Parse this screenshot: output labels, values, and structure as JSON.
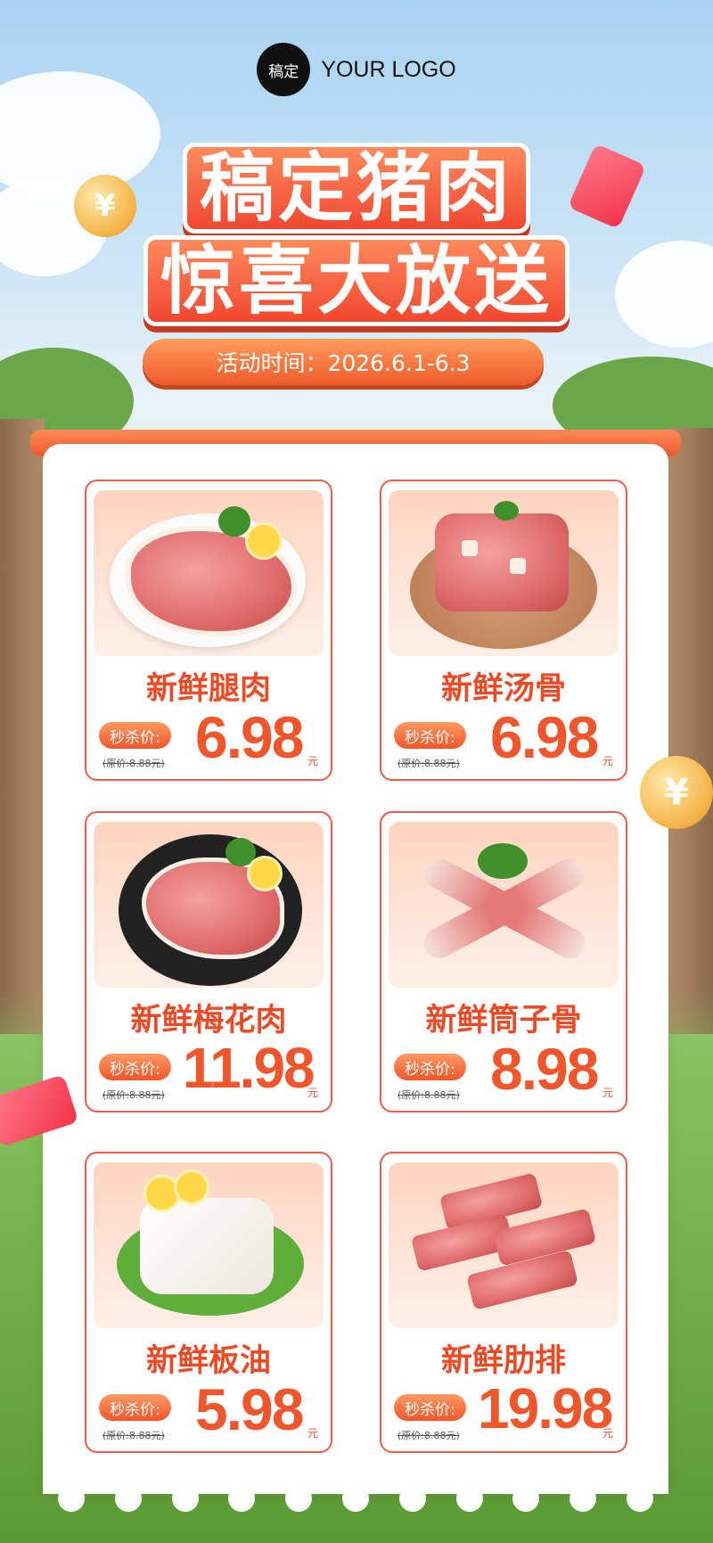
{
  "logo": {
    "badge": "稿定",
    "text": "YOUR LOGO"
  },
  "title": {
    "line1": "稿定猪肉",
    "line2": "惊喜大放送"
  },
  "event": {
    "label": "活动时间：2026.6.1-6.3"
  },
  "coin": {
    "symbol": "¥"
  },
  "colors": {
    "accent": "#f0562b",
    "card_border": "#f05a4a",
    "title_fill": "#f0472e"
  },
  "products": [
    {
      "name": "新鲜腿肉",
      "tag": "秒杀价:",
      "price": "6.98",
      "unit": "元",
      "original": "(原价:8.88元)"
    },
    {
      "name": "新鲜汤骨",
      "tag": "秒杀价:",
      "price": "6.98",
      "unit": "元",
      "original": "(原价:8.88元)"
    },
    {
      "name": "新鲜梅花肉",
      "tag": "秒杀价:",
      "price": "11.98",
      "unit": "元",
      "original": "(原价:8.88元)"
    },
    {
      "name": "新鲜筒子骨",
      "tag": "秒杀价:",
      "price": "8.98",
      "unit": "元",
      "original": "(原价:8.88元)"
    },
    {
      "name": "新鲜板油",
      "tag": "秒杀价:",
      "price": "5.98",
      "unit": "元",
      "original": "(原价:8.88元)"
    },
    {
      "name": "新鲜肋排",
      "tag": "秒杀价:",
      "price": "19.98",
      "unit": "元",
      "original": "(原价:8.88元)"
    }
  ]
}
